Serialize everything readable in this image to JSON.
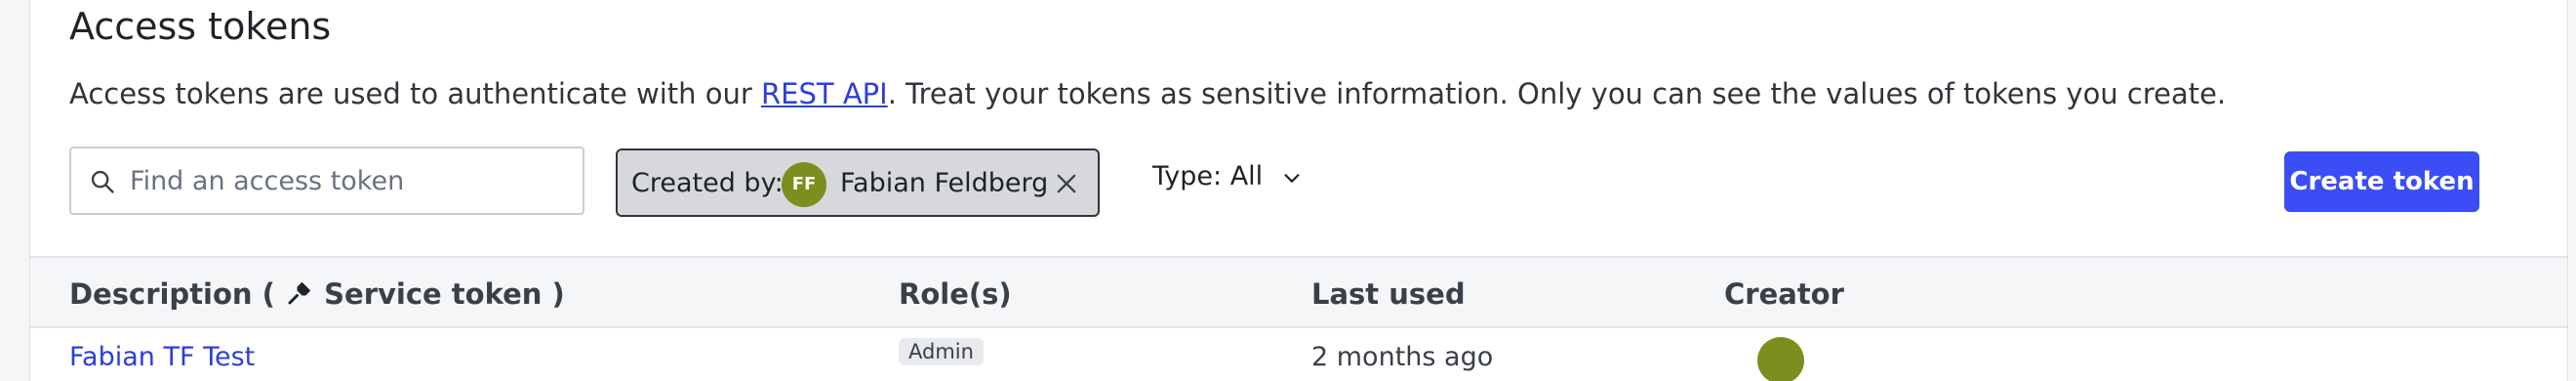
{
  "header": {
    "title": "Access tokens"
  },
  "description": {
    "before_link": "Access tokens are used to authenticate with our ",
    "link": "REST API",
    "after_link": ". Treat your tokens as sensitive information. Only you can see the values of tokens you create."
  },
  "search": {
    "placeholder": "Find an access token",
    "value": ""
  },
  "filter_chip": {
    "label": "Created by:",
    "avatar_initials": "FF",
    "name": "Fabian Feldberg",
    "avatar_color": "#7b8f1f"
  },
  "type_filter": {
    "label": "Type: All"
  },
  "actions": {
    "create_label": "Create token"
  },
  "table": {
    "columns": {
      "description": "Description (",
      "description_suffix": " Service token )",
      "roles": "Role(s)",
      "last_used": "Last used",
      "creator": "Creator"
    },
    "rows": [
      {
        "name": "Fabian TF Test",
        "role": "Admin",
        "last_used": "2 months ago"
      }
    ]
  },
  "colors": {
    "accent": "#3b4ef5",
    "link": "#2c3fd6"
  }
}
